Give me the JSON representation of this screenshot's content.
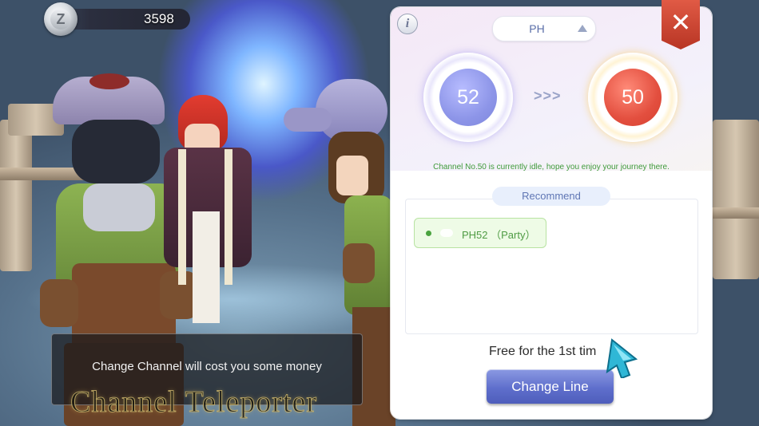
{
  "hud": {
    "currency_icon": "zeny-coin-icon",
    "zeny_amount": "3598"
  },
  "npc_dialog": {
    "message": "Change Channel will cost you some money",
    "npc_name": "Channel Teleporter"
  },
  "channel_panel": {
    "info_icon": "info-icon",
    "server": {
      "selected": "PH",
      "caret_icon": "triangle-up-icon"
    },
    "close_icon": "close-icon",
    "current_channel": "52",
    "arrows": ">>>",
    "target_channel": "50",
    "idle_message": "Channel No.50 is currently idle, hope you enjoy your journey there.",
    "recommend_tab": "Recommend",
    "recommend_items": [
      {
        "label": "PH52 （Party）",
        "status_color": "#4aa33f"
      }
    ],
    "free_text": "Free for the 1st tim",
    "change_button": "Change Line",
    "colors": {
      "current_core": "#8d95e8",
      "target_core": "#e34f3f",
      "close_button": "#c9412f",
      "change_button": "#5f6fcc",
      "idle_text": "#3f9a3a"
    }
  }
}
